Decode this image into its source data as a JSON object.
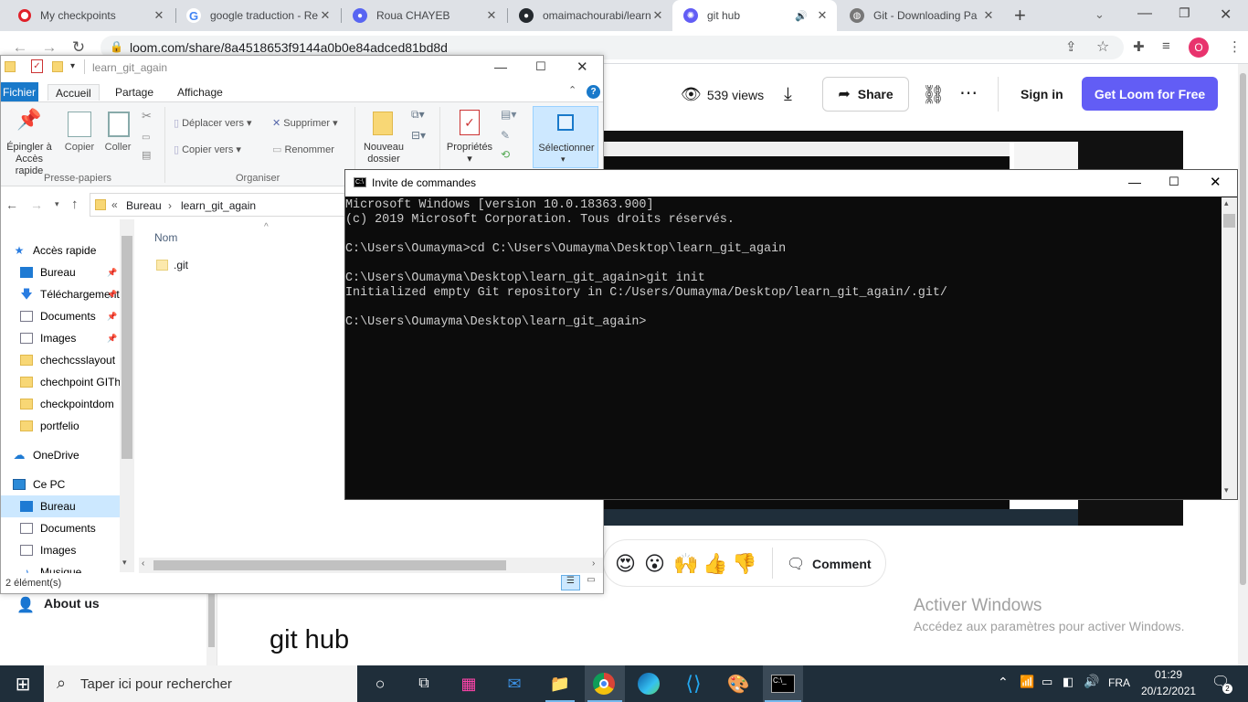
{
  "browser": {
    "tabs": [
      {
        "title": "My checkpoints",
        "icon": "opera-icon"
      },
      {
        "title": "google traduction - Re",
        "icon": "google-icon"
      },
      {
        "title": "Roua CHAYEB",
        "icon": "discord-icon"
      },
      {
        "title": "omaimachourabi/learn",
        "icon": "github-icon"
      },
      {
        "title": "git hub",
        "icon": "loom-icon"
      },
      {
        "title": "Git - Downloading Pa",
        "icon": "globe-icon"
      }
    ],
    "url": "loom.com/share/8a4518653f9144a0b0e84adced81bd8d",
    "profile_initial": "O"
  },
  "loom": {
    "views": "539 views",
    "share_label": "Share",
    "signin_label": "Sign in",
    "get_loom_label": "Get Loom for Free",
    "comment_label": "Comment",
    "reactions": [
      "😍",
      "😮",
      "🙌",
      "👍",
      "👎"
    ],
    "about_label": "About us",
    "video_title": "git hub",
    "activate_title": "Activer Windows",
    "activate_sub": "Accédez aux paramètres pour activer Windows.",
    "accent_color": "#625df5"
  },
  "explorer": {
    "title": "learn_git_again",
    "tabs": [
      "Fichier",
      "Accueil",
      "Partage",
      "Affichage"
    ],
    "ribbon": {
      "pin": "Épingler à Accès rapide",
      "copy": "Copier",
      "paste": "Coller",
      "move_to": "Déplacer vers",
      "copy_to": "Copier vers",
      "delete": "Supprimer",
      "rename": "Renommer",
      "new_folder": "Nouveau dossier",
      "properties": "Propriétés",
      "select": "Sélectionner",
      "group_clipboard": "Presse-papiers",
      "group_organize": "Organiser"
    },
    "breadcrumb": [
      "Bureau",
      "learn_git_again"
    ],
    "column_name": "Nom",
    "files": [
      ".git"
    ],
    "nav": [
      {
        "label": "Accès rapide",
        "type": "star"
      },
      {
        "label": "Bureau",
        "type": "desk",
        "pinned": true
      },
      {
        "label": "Téléchargements",
        "type": "down",
        "pinned": true
      },
      {
        "label": "Documents",
        "type": "doc",
        "pinned": true
      },
      {
        "label": "Images",
        "type": "img",
        "pinned": true
      },
      {
        "label": "chechcsslayout",
        "type": "folder"
      },
      {
        "label": "chechpoint GITh",
        "type": "folder"
      },
      {
        "label": "checkpointdom",
        "type": "folder"
      },
      {
        "label": "portfelio",
        "type": "folder"
      },
      {
        "label": "OneDrive",
        "type": "cloud"
      },
      {
        "label": "Ce PC",
        "type": "pc"
      },
      {
        "label": "Bureau",
        "type": "desk"
      },
      {
        "label": "Documents",
        "type": "doc"
      },
      {
        "label": "Images",
        "type": "img"
      },
      {
        "label": "Musique",
        "type": "music"
      }
    ],
    "status": "2 élément(s)"
  },
  "cmd": {
    "title": "Invite de commandes",
    "lines": [
      "Microsoft Windows [version 10.0.18363.900]",
      "(c) 2019 Microsoft Corporation. Tous droits réservés.",
      "",
      "C:\\Users\\Oumayma>cd C:\\Users\\Oumayma\\Desktop\\learn_git_again",
      "",
      "C:\\Users\\Oumayma\\Desktop\\learn_git_again>git init",
      "Initialized empty Git repository in C:/Users/Oumayma/Desktop/learn_git_again/.git/",
      "",
      "C:\\Users\\Oumayma\\Desktop\\learn_git_again>"
    ]
  },
  "taskbar": {
    "search_placeholder": "Taper ici pour rechercher",
    "lang": "FRA",
    "time": "01:29",
    "date": "20/12/2021",
    "notif_count": "2"
  }
}
